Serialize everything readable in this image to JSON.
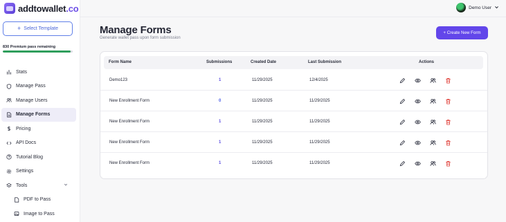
{
  "brand": {
    "name": "addtowallet",
    "tld": ".co"
  },
  "sidebar": {
    "select_template_label": "Select Template",
    "premium_text": "830 Premium pass remaining",
    "premium_progress": 0.97,
    "items": [
      {
        "label": "Stats",
        "icon": "bar-chart-icon"
      },
      {
        "label": "Manage Pass",
        "icon": "shield-icon"
      },
      {
        "label": "Manage Users",
        "icon": "users-icon"
      },
      {
        "label": "Manage Forms",
        "icon": "document-icon",
        "active": true
      },
      {
        "label": "Pricing",
        "icon": "dollar-icon"
      },
      {
        "label": "API Docs",
        "icon": "code-icon"
      },
      {
        "label": "Tutorial Blog",
        "icon": "help-circle-icon"
      },
      {
        "label": "Settings",
        "icon": "gear-icon"
      },
      {
        "label": "Tools",
        "icon": "layers-icon",
        "expandable": true
      },
      {
        "label": "PDF to Pass",
        "icon": "file-icon",
        "sub": true
      },
      {
        "label": "Image to Pass",
        "icon": "image-icon",
        "sub": true
      }
    ]
  },
  "user": {
    "name": "Demo User"
  },
  "header": {
    "title": "Manage Forms",
    "subtitle": "Generate wallet pass upon form submission",
    "create_button": "+ Create New Form"
  },
  "table": {
    "columns": [
      "Form Name",
      "Submissions",
      "Created Date",
      "Last Submission",
      "Actions"
    ],
    "rows": [
      {
        "name": "Demo123",
        "submissions": "1",
        "created": "11/29/2025",
        "last": "12/4/2025"
      },
      {
        "name": "New Enrollment Form",
        "submissions": "0",
        "created": "11/29/2025",
        "last": "11/29/2025"
      },
      {
        "name": "New Enrollment Form",
        "submissions": "1",
        "created": "11/29/2025",
        "last": "11/29/2025"
      },
      {
        "name": "New Enrollment Form",
        "submissions": "1",
        "created": "11/29/2025",
        "last": "11/29/2025"
      },
      {
        "name": "New Enrollment Form",
        "submissions": "1",
        "created": "11/29/2025",
        "last": "11/29/2025"
      }
    ]
  },
  "colors": {
    "accent": "#6246ea",
    "delete": "#e0413a",
    "progress": "#2f9e5c"
  }
}
